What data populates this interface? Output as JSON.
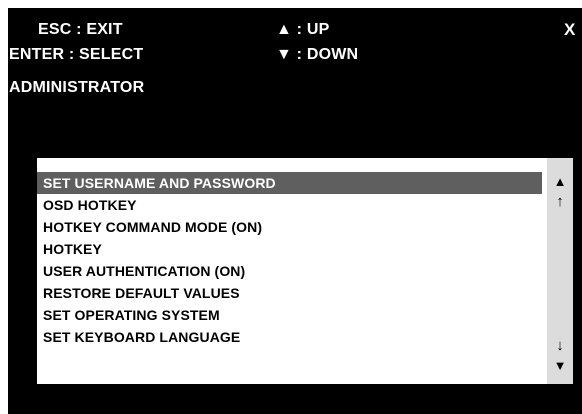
{
  "header": {
    "esc_hint": "ESC : EXIT",
    "enter_hint": "ENTER : SELECT",
    "up_hint": "▲ : UP",
    "down_hint": "▼ : DOWN",
    "close_glyph": "X",
    "title": "ADMINISTRATOR"
  },
  "menu": {
    "selected_index": 0,
    "items": [
      {
        "label": "SET USERNAME AND PASSWORD"
      },
      {
        "label": "OSD HOTKEY"
      },
      {
        "label": "HOTKEY COMMAND MODE (ON)"
      },
      {
        "label": "HOTKEY"
      },
      {
        "label": "USER AUTHENTICATION (ON)"
      },
      {
        "label": "RESTORE DEFAULT VALUES"
      },
      {
        "label": "SET OPERATING SYSTEM"
      },
      {
        "label": "SET KEYBOARD LANGUAGE"
      }
    ]
  },
  "scrollbar": {
    "top_glyph": "▲",
    "up_glyph": "↑",
    "down_glyph": "↓",
    "bottom_glyph": "▼"
  },
  "colors": {
    "screen_background": "#000000",
    "panel_background": "#ffffff",
    "selected_background": "#5f5f5f",
    "scrollbar_background": "#dcdcdc"
  }
}
